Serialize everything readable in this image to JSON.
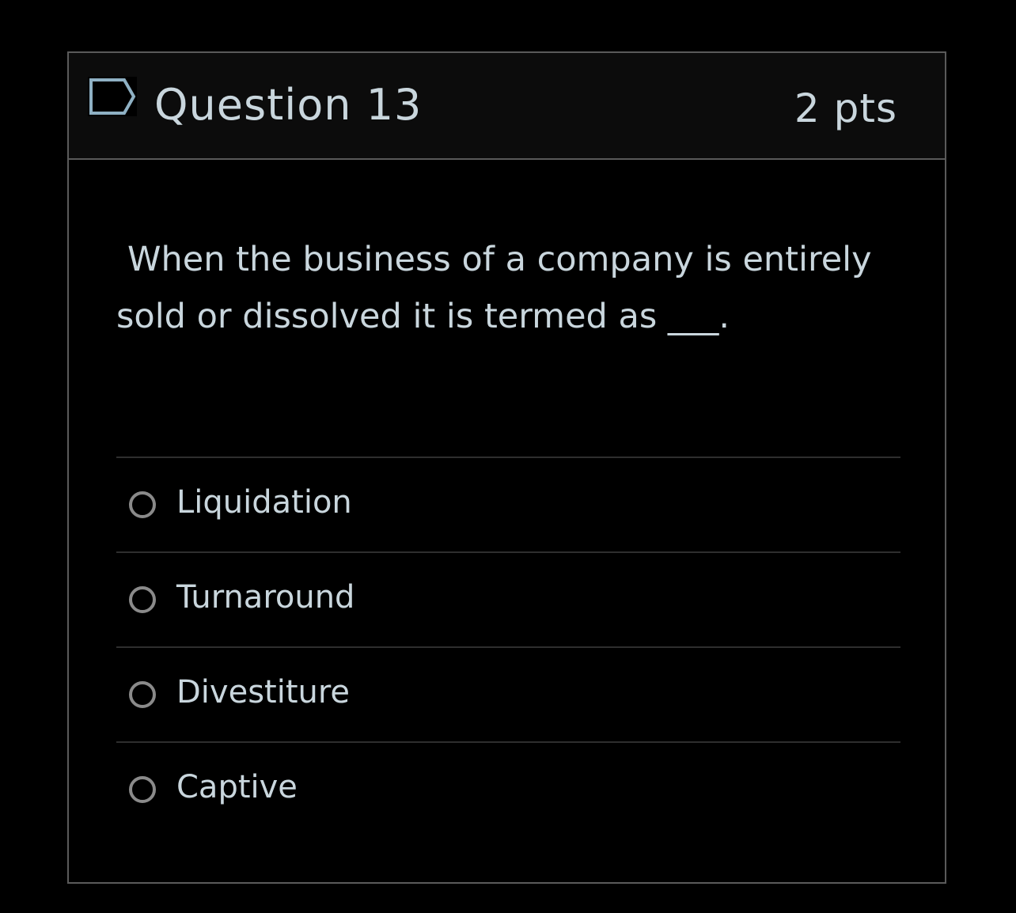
{
  "question": {
    "title": "Question 13",
    "points": "2 pts",
    "text": "When the business of a company is entirely sold or dissolved it is termed as ___.",
    "flag_icon": "flag-outline-icon"
  },
  "answers": [
    {
      "label": "Liquidation"
    },
    {
      "label": "Turnaround"
    },
    {
      "label": "Divestiture"
    },
    {
      "label": "Captive"
    }
  ],
  "colors": {
    "background": "#000000",
    "header_bg": "#0c0c0c",
    "border": "#5a5a5a",
    "text": "#c9d6dd",
    "radio": "#8a8a8a",
    "flag_stroke": "#8fb1c4"
  }
}
